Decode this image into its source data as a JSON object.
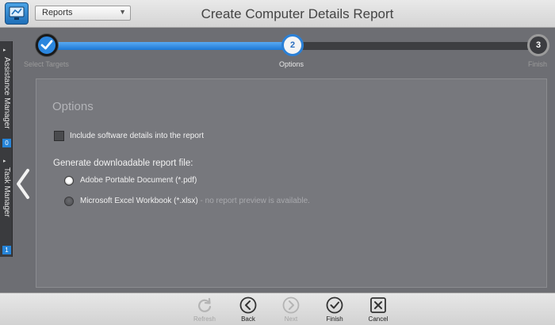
{
  "header": {
    "module_select_value": "Reports",
    "window_title": "Create Computer Details Report"
  },
  "dock": {
    "assistance": {
      "label": "Assistance Manager",
      "count": "0"
    },
    "task": {
      "label": "Task Manager",
      "count": "1"
    }
  },
  "stepper": {
    "steps": [
      {
        "number": "",
        "label": "Select Targets",
        "state": "done"
      },
      {
        "number": "2",
        "label": "Options",
        "state": "current"
      },
      {
        "number": "3",
        "label": "Finish",
        "state": "upcoming"
      }
    ]
  },
  "options": {
    "title": "Options",
    "include_software_label": "Include software details into the report",
    "include_software_checked": false,
    "generate_label": "Generate downloadable report file:",
    "formats": [
      {
        "label": "Adobe Portable Document (*.pdf)",
        "note": "",
        "selected": true
      },
      {
        "label": "Microsoft Excel Workbook (*.xlsx)",
        "note": " - no report preview is available.",
        "selected": false
      }
    ]
  },
  "toolbar": {
    "refresh": "Refresh",
    "back": "Back",
    "next": "Next",
    "finish": "Finish",
    "cancel": "Cancel"
  },
  "colors": {
    "accent": "#2b86de",
    "panel": "#77787d",
    "background": "#6d6e73"
  }
}
